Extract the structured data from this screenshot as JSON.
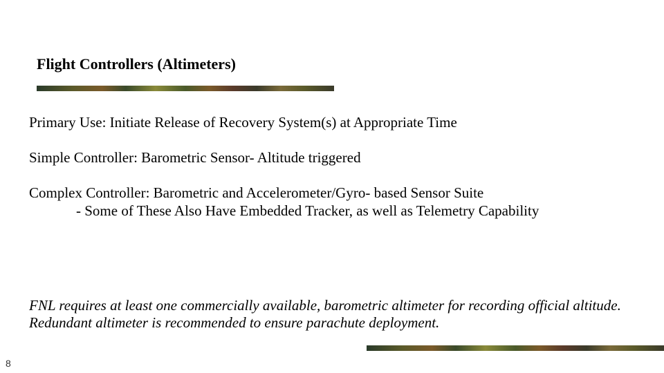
{
  "title": "Flight Controllers (Altimeters)",
  "body": {
    "primary_use": "Primary Use: Initiate Release of Recovery System(s) at Appropriate Time",
    "simple_controller": "Simple Controller: Barometric Sensor- Altitude triggered",
    "complex_controller_line1": "Complex Controller: Barometric and Accelerometer/Gyro- based Sensor Suite",
    "complex_controller_line2": "- Some of These Also Have Embedded Tracker, as well as Telemetry Capability"
  },
  "note": "FNL requires at least one commercially available, barometric altimeter for recording official altitude. Redundant altimeter is recommended to ensure parachute deployment.",
  "page_number": "8"
}
